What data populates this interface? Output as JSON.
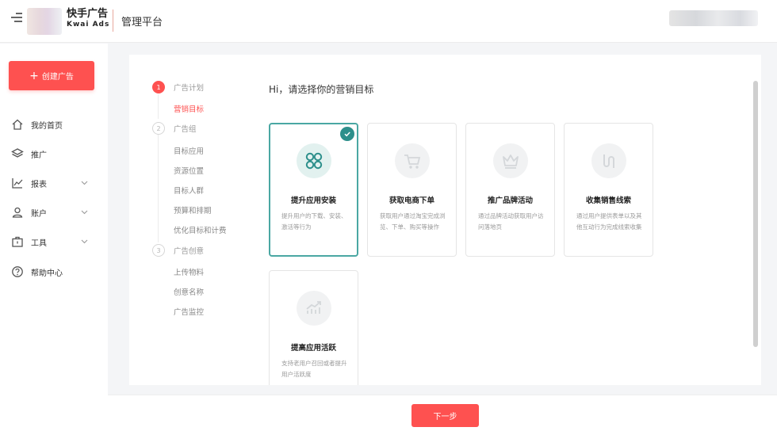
{
  "header": {
    "logo_cn": "快手广告",
    "logo_en": "Kwai Ads",
    "platform": "管理平台"
  },
  "sidebar": {
    "create_label": "创建广告",
    "items": [
      {
        "label": "我的首页",
        "icon": "home-icon",
        "expandable": false
      },
      {
        "label": "推广",
        "icon": "layers-icon",
        "expandable": false
      },
      {
        "label": "报表",
        "icon": "chart-icon",
        "expandable": true
      },
      {
        "label": "账户",
        "icon": "user-icon",
        "expandable": true
      },
      {
        "label": "工具",
        "icon": "toolbox-icon",
        "expandable": true
      },
      {
        "label": "帮助中心",
        "icon": "help-icon",
        "expandable": false
      }
    ]
  },
  "steps": [
    {
      "number": "1",
      "title": "广告计划",
      "active": true,
      "subs": [
        {
          "label": "营销目标",
          "active": true
        }
      ]
    },
    {
      "number": "2",
      "title": "广告组",
      "active": false,
      "subs": [
        {
          "label": "目标应用",
          "active": false
        },
        {
          "label": "资源位置",
          "active": false
        },
        {
          "label": "目标人群",
          "active": false
        },
        {
          "label": "预算和排期",
          "active": false
        },
        {
          "label": "优化目标和计费",
          "active": false
        }
      ]
    },
    {
      "number": "3",
      "title": "广告创意",
      "active": false,
      "subs": [
        {
          "label": "上传物料",
          "active": false
        },
        {
          "label": "创意名称",
          "active": false
        },
        {
          "label": "广告监控",
          "active": false
        }
      ]
    }
  ],
  "main": {
    "heading": "Hi，请选择你的营销目标",
    "cards": [
      {
        "title": "提升应用安装",
        "desc": "提升用户的下载、安装、激活等行为",
        "icon": "apps-icon",
        "selected": true
      },
      {
        "title": "获取电商下单",
        "desc": "获取用户通过淘宝完成浏览、下单、购买等操作",
        "icon": "cart-icon",
        "selected": false
      },
      {
        "title": "推广品牌活动",
        "desc": "通过品牌活动获取用户访问落地页",
        "icon": "crown-icon",
        "selected": false
      },
      {
        "title": "收集销售线索",
        "desc": "通过用户提供表单以及其他互动行为完成线索收集",
        "icon": "funnel-icon",
        "selected": false
      },
      {
        "title": "提高应用活跃",
        "desc": "支持老用户召回或者提升用户活跃度",
        "icon": "trend-icon",
        "selected": false
      }
    ]
  },
  "footer": {
    "next_label": "下一步"
  },
  "colors": {
    "accent": "#fe5150",
    "selected_border": "#4aa7a3",
    "check": "#2d8f8b"
  }
}
